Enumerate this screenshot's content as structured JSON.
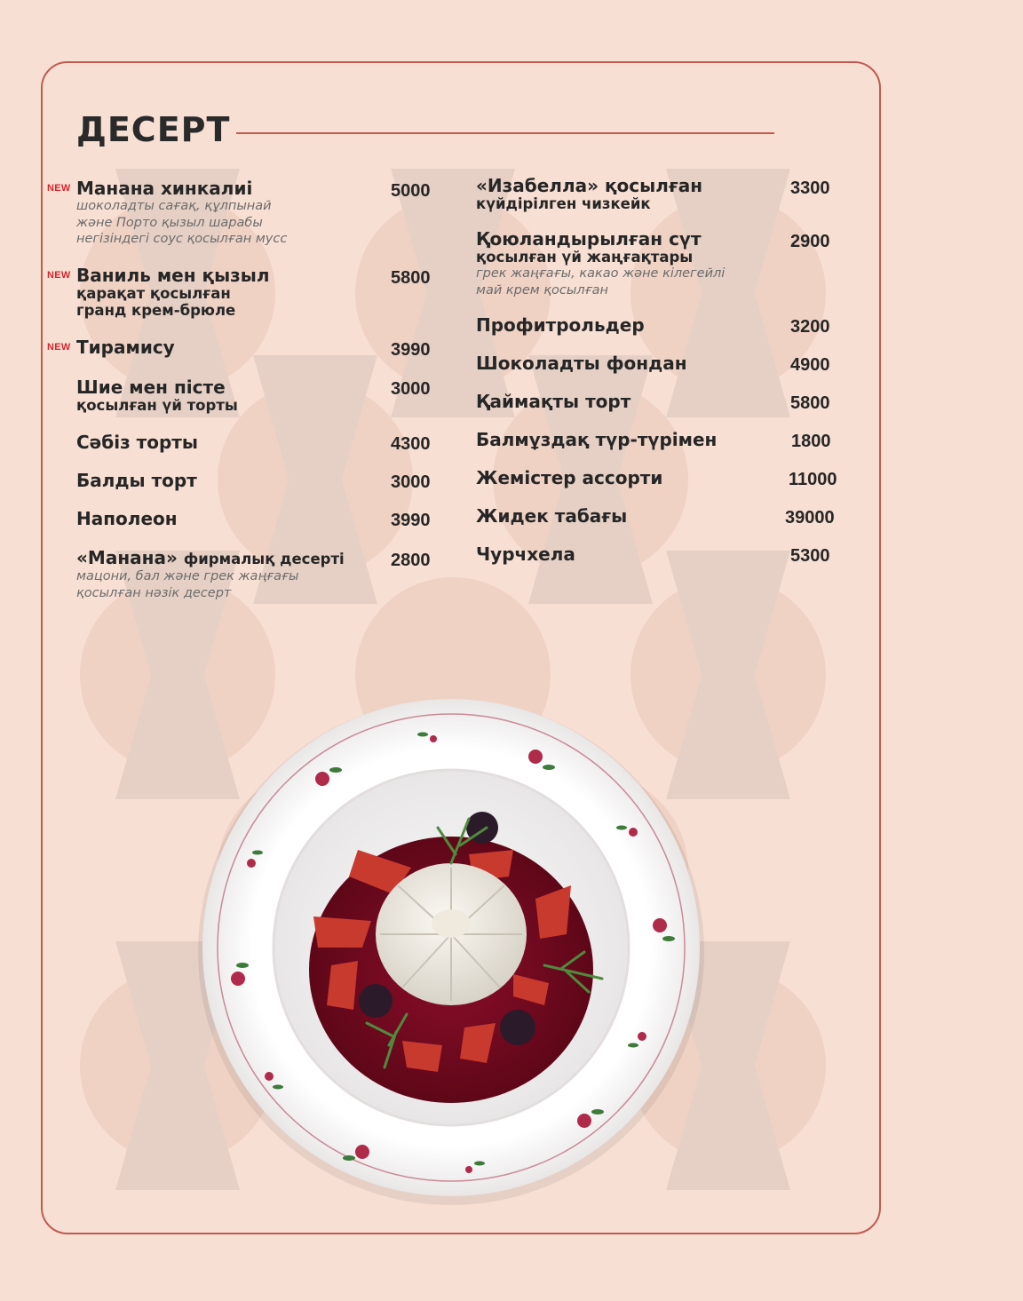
{
  "section": {
    "title": "ДЕСЕРТ"
  },
  "badges": {
    "new": "NEW"
  },
  "menu": {
    "left": [
      {
        "name": "Манана хинкалиі",
        "price": "5000",
        "desc": [
          "шоколадты сағақ, құлпынай",
          "және Порто қызыл шарабы",
          "негізіндегі соус қосылған мусс"
        ]
      },
      {
        "name": "Ваниль мен қызыл",
        "name2": [
          "қарақат қосылған",
          "гранд крем-брюле"
        ],
        "price": "5800"
      },
      {
        "name": "Тирамису",
        "price": "3990"
      },
      {
        "name": "Шие мен пісте",
        "name2": [
          "қосылған үй торты"
        ],
        "price": "3000"
      },
      {
        "name": "Сәбіз торты",
        "price": "4300"
      },
      {
        "name": "Балды торт",
        "price": "3000"
      },
      {
        "name": "Наполеон",
        "price": "3990"
      },
      {
        "name": "«Манана»",
        "name_suffix": "фирмалық десерті",
        "price": "2800",
        "desc": [
          "мацони, бал және грек жаңғағы",
          "қосылған нәзік десерт"
        ]
      }
    ],
    "right": [
      {
        "name": "«Изабелла» қосылған",
        "name2": [
          "күйдірілген чизкейк"
        ],
        "price": "3300"
      },
      {
        "name": "Қоюландырылған сүт",
        "name2": [
          "қосылған үй жаңғақтары"
        ],
        "price": "2900",
        "desc": [
          "грек жаңғағы, какао және кілегейлі",
          "май крем қосылған"
        ]
      },
      {
        "name": "Профитрольдер",
        "price": "3200"
      },
      {
        "name": "Шоколадты фондан",
        "price": "4900"
      },
      {
        "name": "Қаймақты торт",
        "price": "5800"
      },
      {
        "name": "Балмұздақ түр-түрімен",
        "price": "1800"
      },
      {
        "name": "Жемістер ассорти",
        "price": "11000"
      },
      {
        "name": "Жидек табағы",
        "price": "39000"
      },
      {
        "name": "Чурчхела",
        "price": "5300"
      }
    ]
  },
  "colors": {
    "accent": "#c25a4f",
    "background": "#f8dfd3",
    "new_badge": "#d7262d"
  }
}
